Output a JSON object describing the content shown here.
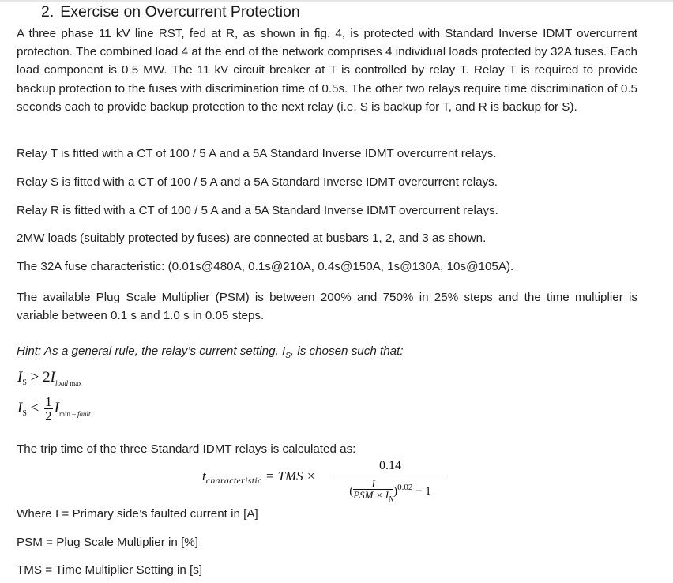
{
  "section": {
    "number": "2.",
    "title": "Exercise on Overcurrent Protection"
  },
  "intro_paragraph": "A three phase 11 kV line RST, fed at R, as shown in fig. 4, is protected with Standard Inverse IDMT overcurrent protection. The combined load 4 at the end of the network comprises 4 individual loads protected by 32A fuses. Each load component is 0.5 MW. The 11 kV circuit breaker at T is controlled by relay T. Relay T is required to provide backup protection to the fuses with discrimination time of 0.5s. The other two relays require time discrimination of 0.5 seconds each to provide backup protection to the next relay (i.e. S is backup for T, and R is backup for S).",
  "relay_lines": [
    "Relay T is fitted with a CT of 100 / 5 A and a 5A Standard Inverse IDMT overcurrent relays.",
    "Relay S is fitted with a CT of 100 / 5 A and a 5A Standard Inverse IDMT overcurrent relays.",
    "Relay R is fitted with a CT of 100 / 5 A and a 5A Standard Inverse IDMT overcurrent relays."
  ],
  "loads_line": "2MW loads (suitably protected by fuses) are connected at busbars 1, 2, and 3 as shown.",
  "fuse_line": "The 32A fuse characteristic: (0.01s@480A, 0.1s@210A, 0.4s@150A, 1s@130A, 10s@105A).",
  "psm_paragraph": "The available Plug Scale Multiplier (PSM) is between 200% and 750% in 25% steps and the time multiplier is variable between 0.1 s and 1.0 s in 0.05 steps.",
  "hint": {
    "prefix": "Hint: As a general rule, the relay’s current setting, I",
    "sub": "S",
    "suffix": ", is chosen such that:"
  },
  "rule1": {
    "lhs": "I",
    "lhs_sub": "S",
    "op": " > 2",
    "rhs": "I",
    "rhs_sub_italic": "load",
    "rhs_sub_plain": " max"
  },
  "rule2": {
    "lhs": "I",
    "lhs_sub": "S",
    "op": " < ",
    "frac_num": "1",
    "frac_den": "2",
    "rhs": "I",
    "rhs_sub_plain": "min – ",
    "rhs_sub_italic": "fault"
  },
  "trip_intro": "The trip time of the three Standard IDMT relays is calculated as:",
  "trip_formula": {
    "lhs": "t",
    "lhs_sub": "characteristic",
    "equals": " = TMS × ",
    "numerator": "0.14",
    "inner_num": "I",
    "inner_den": "PSM × I",
    "inner_den_sub": "N",
    "exponent": "0.02",
    "minus": " − 1"
  },
  "definitions": [
    "Where I = Primary side’s faulted current in [A]",
    "PSM = Plug Scale Multiplier in [%]",
    "TMS = Time Multiplier Setting in [s]"
  ]
}
